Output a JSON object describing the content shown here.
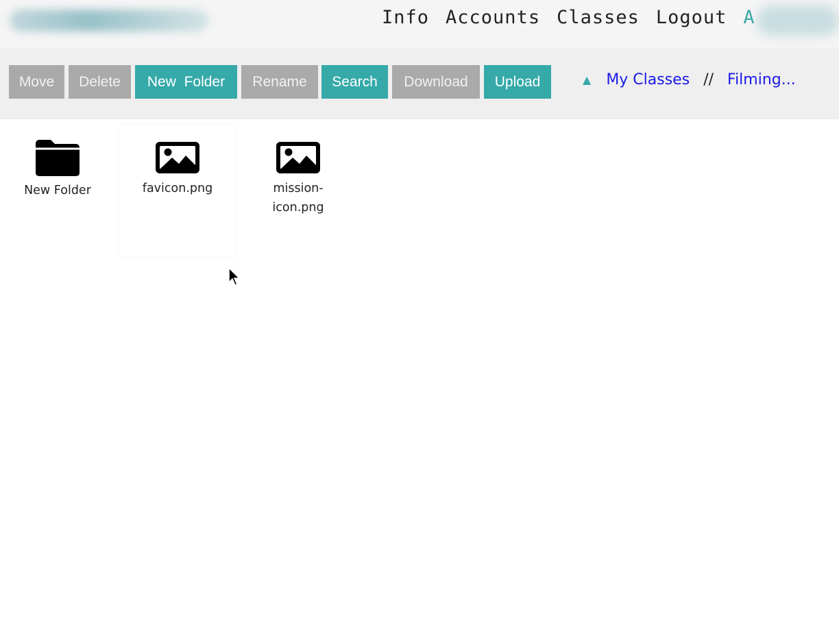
{
  "nav": {
    "links": [
      "Info",
      "Accounts",
      "Classes",
      "Logout"
    ],
    "user_initial": "A"
  },
  "toolbar": {
    "buttons": [
      {
        "label": "Move",
        "state": "disabled"
      },
      {
        "label": "Delete",
        "state": "disabled"
      },
      {
        "label": "New  Folder",
        "state": "active"
      },
      {
        "label": "Rename",
        "state": "disabled"
      },
      {
        "label": "Search",
        "state": "active"
      },
      {
        "label": "Download",
        "state": "disabled"
      },
      {
        "label": "Upload",
        "state": "active"
      }
    ]
  },
  "breadcrumb": {
    "up_icon": "up-triangle-icon",
    "items": [
      "My Classes",
      "Filming..."
    ],
    "separator": "//"
  },
  "files": [
    {
      "name": "New Folder",
      "icon": "folder-icon"
    },
    {
      "name": "favicon.png",
      "icon": "image-icon"
    },
    {
      "name": "mission-icon.png",
      "name_display": "mission-\nicon.png",
      "icon": "image-icon"
    }
  ],
  "colors": {
    "accent": "#36a9a9",
    "disabled": "#aaaaaa",
    "link": "#1a1ae6"
  }
}
